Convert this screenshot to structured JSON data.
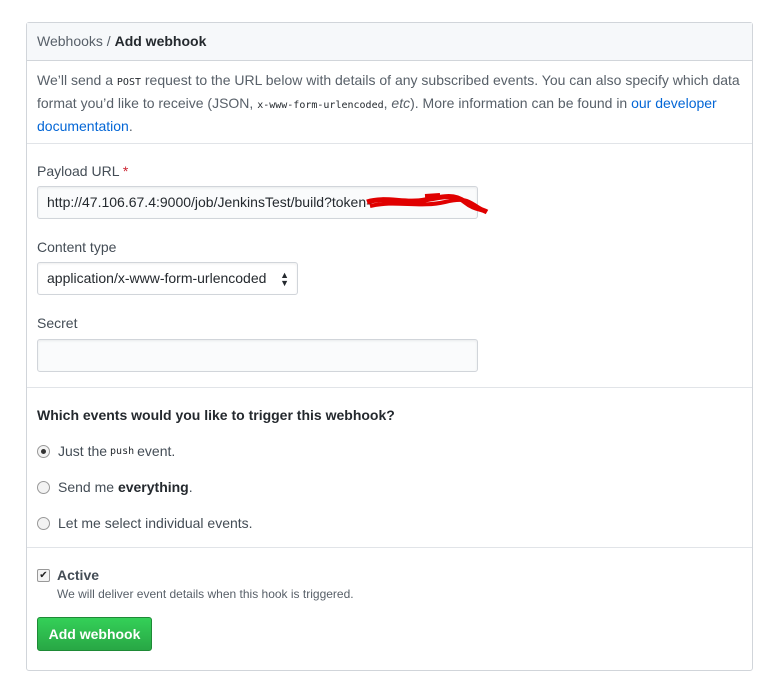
{
  "header": {
    "breadcrumb_parent": "Webhooks",
    "separator": " / ",
    "breadcrumb_current": "Add webhook"
  },
  "intro": {
    "t1": "We’ll send a ",
    "code1": "POST",
    "t2": " request to the URL below with details of any subscribed events. You can also specify which data format you’d like to receive (JSON, ",
    "code2": "x-www-form-urlencoded",
    "t3": ", ",
    "etc": "etc",
    "t4": "). More information can be found in ",
    "link": "our developer documentation",
    "t5": "."
  },
  "payload": {
    "label": "Payload URL",
    "required": "*",
    "value": "http://47.106.67.4:9000/job/JenkinsTest/build?token="
  },
  "content_type": {
    "label": "Content type",
    "selected": "application/x-www-form-urlencoded",
    "arrow_icon": "up-down-caret"
  },
  "secret": {
    "label": "Secret",
    "value": ""
  },
  "events": {
    "question": "Which events would you like to trigger this webhook?",
    "options": [
      {
        "pre": "Just the ",
        "code": "push",
        "post": " event.",
        "checked": true
      },
      {
        "pre": "Send me ",
        "bold": "everything",
        "post": ".",
        "checked": false
      },
      {
        "pre": "Let me select individual events.",
        "checked": false
      }
    ]
  },
  "active": {
    "label": "Active",
    "checked": true,
    "description": "We will deliver event details when this hook is triggered."
  },
  "submit": {
    "label": "Add webhook"
  },
  "colors": {
    "button": "#28a745",
    "link": "#0366d6",
    "redaction": "#e00000"
  }
}
